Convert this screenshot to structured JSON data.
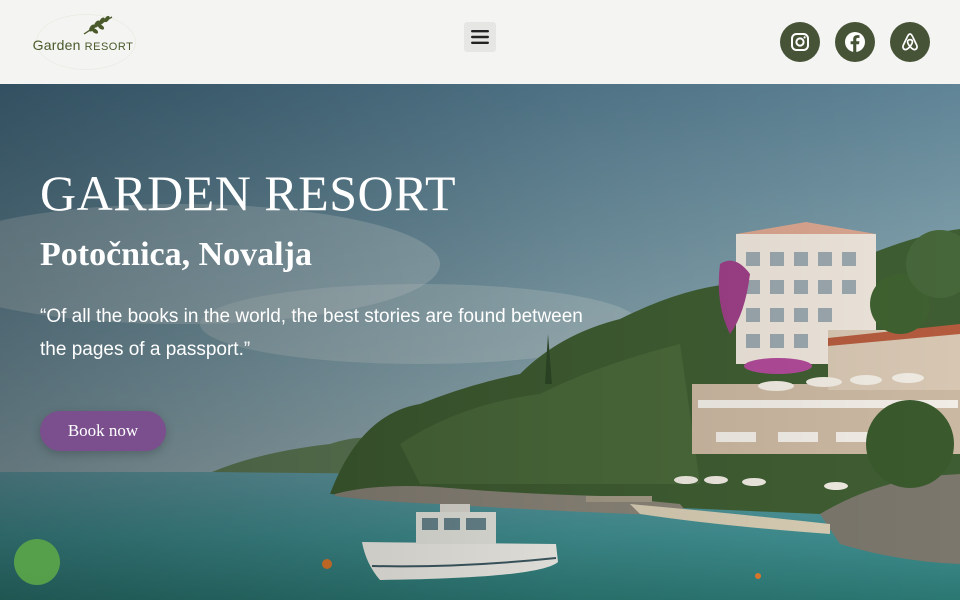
{
  "header": {
    "logo_main": "Garden",
    "logo_sub": "RESORT",
    "menu_icon": "hamburger-icon",
    "social": [
      {
        "name": "instagram-icon"
      },
      {
        "name": "facebook-icon"
      },
      {
        "name": "airbnb-icon"
      }
    ]
  },
  "hero": {
    "title": "GARDEN RESORT",
    "subtitle": "Potočnica, Novalja",
    "quote": "“Of all the books in the world, the best stories are found between the pages of a passport.”",
    "cta_label": "Book now"
  },
  "colors": {
    "header_bg": "#f4f4f2",
    "social_bg": "#475337",
    "cta_bg": "#7b4f8e",
    "chat_bg": "#59a24a"
  }
}
